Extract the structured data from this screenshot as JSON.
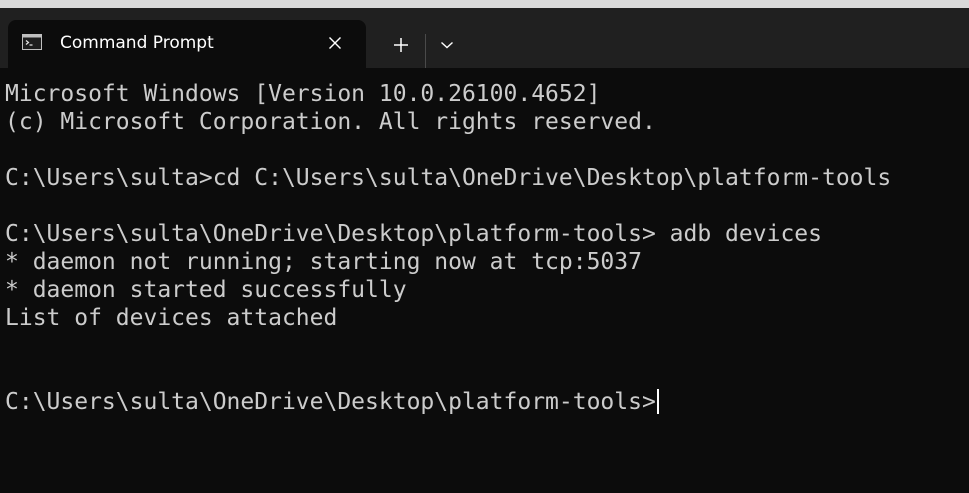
{
  "tab": {
    "title": "Command Prompt",
    "icon": "terminal-icon"
  },
  "tabbar": {
    "close_icon": "close-icon",
    "new_tab_icon": "plus-icon",
    "dropdown_icon": "chevron-down-icon"
  },
  "terminal": {
    "lines": [
      "Microsoft Windows [Version 10.0.26100.4652]",
      "(c) Microsoft Corporation. All rights reserved.",
      "",
      "C:\\Users\\sulta>cd C:\\Users\\sulta\\OneDrive\\Desktop\\platform-tools",
      "",
      "C:\\Users\\sulta\\OneDrive\\Desktop\\platform-tools> adb devices",
      "* daemon not running; starting now at tcp:5037",
      "* daemon started successfully",
      "List of devices attached",
      "",
      "",
      "C:\\Users\\sulta\\OneDrive\\Desktop\\platform-tools>"
    ]
  },
  "colors": {
    "background": "#0c0c0c",
    "tabbar": "#202020",
    "text": "#cccccc"
  }
}
